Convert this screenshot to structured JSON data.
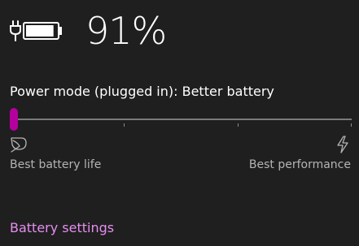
{
  "battery": {
    "percent_text": "91%",
    "level": 0.91,
    "charging": true,
    "icon": "battery-charging-icon"
  },
  "power_mode": {
    "label": "Power mode (plugged in): Better battery",
    "slider": {
      "value": 0,
      "min": 0,
      "max": 3,
      "ticks": [
        1,
        2,
        3
      ]
    },
    "left_icon": "leaf-icon",
    "right_icon": "lightning-bolt-icon",
    "left_label": "Best battery life",
    "right_label": "Best performance"
  },
  "links": {
    "battery_settings": "Battery settings"
  },
  "colors": {
    "background": "#1f1f1f",
    "accent": "#b4009e",
    "link": "#e58ef0",
    "track": "#7a7a7a",
    "secondary_text": "#b4b4b4"
  }
}
